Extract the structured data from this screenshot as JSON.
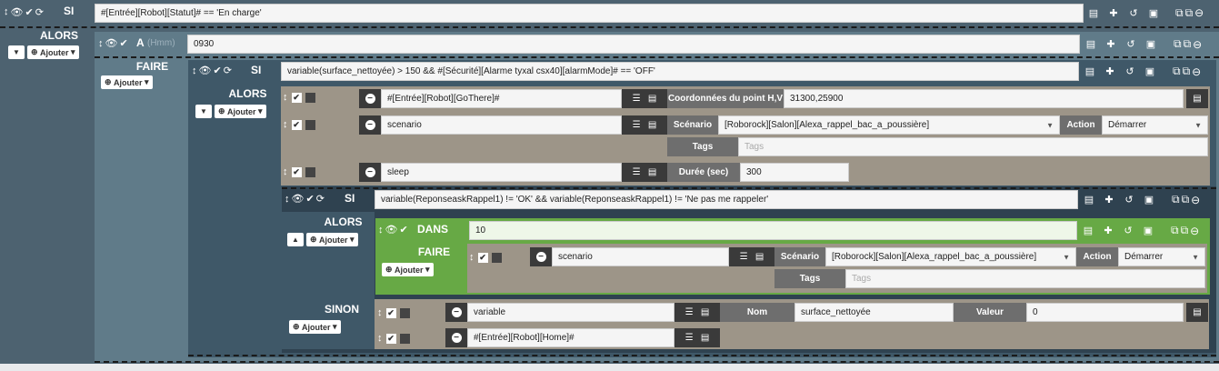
{
  "blocks": {
    "si1": {
      "label": "SI",
      "condition": "#[Entrée][Robot][Statut]# == 'En charge'",
      "alors": "ALORS"
    },
    "a1": {
      "label": "A",
      "hint": "(Hmm)",
      "value": "0930",
      "faire": "FAIRE"
    },
    "si2": {
      "label": "SI",
      "condition": "variable(surface_nettoyée) > 150 && #[Sécurité][Alarme tyxal csx40][alarmMode]# == 'OFF'",
      "alors": "ALORS"
    },
    "act_gothere": {
      "cmd": "#[Entrée][Robot][GoThere]#",
      "param_label": "Coordonnées du point H,V",
      "param_value": "31300,25900"
    },
    "act_scenario1": {
      "cmd": "scenario",
      "scen_label": "Scénario",
      "scen_value": "[Roborock][Salon][Alexa_rappel_bac_a_poussière]",
      "action_label": "Action",
      "action_value": "Démarrer",
      "tags_label": "Tags",
      "tags_placeholder": "Tags"
    },
    "act_sleep": {
      "cmd": "sleep",
      "dur_label": "Durée (sec)",
      "dur_value": "300"
    },
    "si3": {
      "label": "SI",
      "condition": "variable(ReponseaskRappel1) != 'OK' && variable(ReponseaskRappel1) != 'Ne pas me rappeler'",
      "alors": "ALORS",
      "sinon": "SINON"
    },
    "dans": {
      "label": "DANS",
      "value": "10",
      "faire": "FAIRE"
    },
    "act_scenario2": {
      "cmd": "scenario",
      "scen_label": "Scénario",
      "scen_value": "[Roborock][Salon][Alexa_rappel_bac_a_poussière]",
      "action_label": "Action",
      "action_value": "Démarrer",
      "tags_label": "Tags",
      "tags_placeholder": "Tags"
    },
    "act_variable": {
      "cmd": "variable",
      "nom_label": "Nom",
      "nom_value": "surface_nettoyée",
      "val_label": "Valeur",
      "val_value": "0"
    },
    "act_home": {
      "cmd": "#[Entrée][Robot][Home]#"
    }
  },
  "ui": {
    "ajouter": "Ajouter"
  },
  "colors": {
    "panel": "#4d6270",
    "nested": "#607b89",
    "action_row": "#9d9588",
    "dans": "#67a945"
  }
}
